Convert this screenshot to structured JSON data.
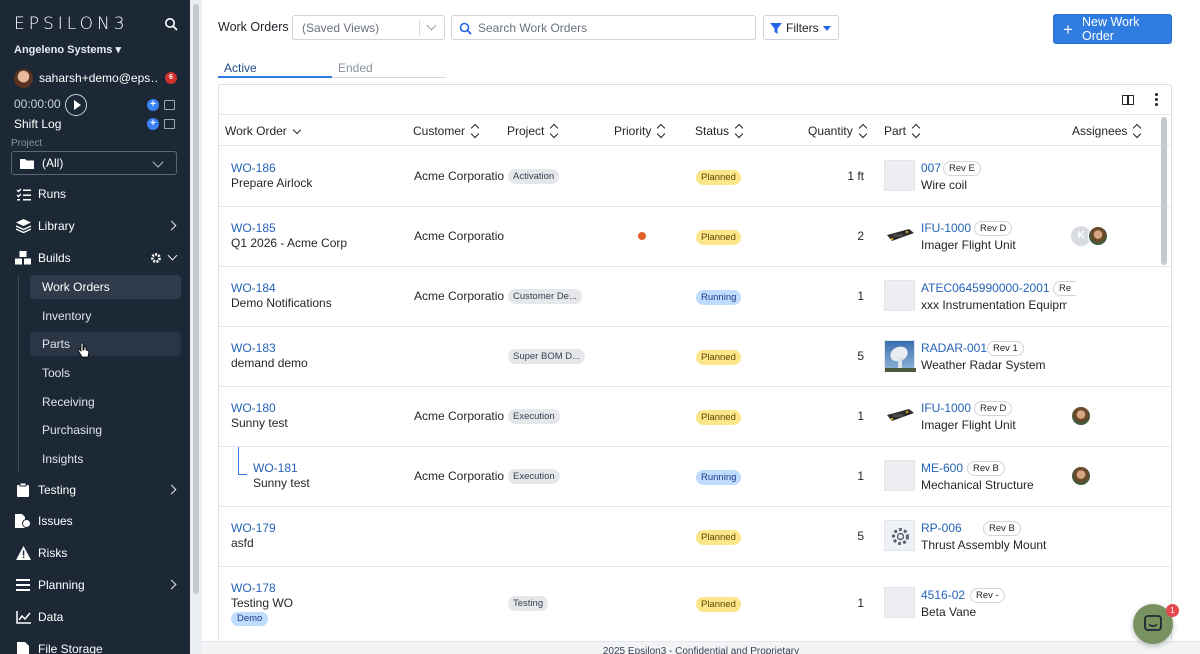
{
  "sidebar": {
    "logo": "EPSILON3",
    "org": "Angeleno Systems",
    "user": "saharsh+demo@eps…",
    "notification_count": "6",
    "timer": "00:00:00",
    "shift_log": "Shift Log",
    "project_label": "Project",
    "project_value": "(All)",
    "nav": {
      "runs": "Runs",
      "library": "Library",
      "builds": "Builds",
      "testing": "Testing",
      "issues": "Issues",
      "risks": "Risks",
      "planning": "Planning",
      "data": "Data",
      "file_storage": "File Storage"
    },
    "builds_sub": [
      "Work Orders",
      "Inventory",
      "Parts",
      "Tools",
      "Receiving",
      "Purchasing",
      "Insights"
    ]
  },
  "toolbar": {
    "title": "Work Orders",
    "saved_views": "(Saved Views)",
    "search_placeholder": "Search Work Orders",
    "filters": "Filters",
    "new_work_order": "New Work Order"
  },
  "tabs": {
    "active": "Active",
    "ended": "Ended"
  },
  "columns": {
    "work_order": "Work Order",
    "customer": "Customer",
    "project": "Project",
    "priority": "Priority",
    "status": "Status",
    "quantity": "Quantity",
    "part": "Part",
    "assignees": "Assignees"
  },
  "rows": [
    {
      "id": "WO-186",
      "name": "Prepare Airlock",
      "customer": "Acme Corporation",
      "project": "Activation",
      "status": "Planned",
      "quantity": "1 ft",
      "part_id": "007",
      "rev": "Rev E",
      "part_name": "Wire coil"
    },
    {
      "id": "WO-185",
      "name": "Q1 2026 - Acme Corp",
      "customer": "Acme Corporation",
      "project": "",
      "status": "Planned",
      "quantity": "2",
      "part_id": "IFU-1000",
      "rev": "Rev D",
      "part_name": "Imager Flight Unit",
      "assignee_initial": "K"
    },
    {
      "id": "WO-184",
      "name": "Demo Notifications",
      "customer": "Acme Corporation",
      "project": "Customer De...",
      "status": "Running",
      "quantity": "1",
      "part_id": "ATEC0645990000-2001",
      "rev": "Re",
      "part_name": "xxx Instrumentation Equipment"
    },
    {
      "id": "WO-183",
      "name": "demand demo",
      "customer": "",
      "project": "Super BOM D...",
      "status": "Planned",
      "quantity": "5",
      "part_id": "RADAR-001",
      "rev": "Rev 1",
      "part_name": "Weather Radar System"
    },
    {
      "id": "WO-180",
      "name": "Sunny test",
      "customer": "Acme Corporation",
      "project": "Execution",
      "status": "Planned",
      "quantity": "1",
      "part_id": "IFU-1000",
      "rev": "Rev D",
      "part_name": "Imager Flight Unit"
    },
    {
      "id": "WO-181",
      "name": "Sunny test",
      "customer": "Acme Corporation",
      "project": "Execution",
      "status": "Running",
      "quantity": "1",
      "part_id": "ME-600",
      "rev": "Rev B",
      "part_name": "Mechanical Structure"
    },
    {
      "id": "WO-179",
      "name": "asfd",
      "customer": "",
      "project": "",
      "status": "Planned",
      "quantity": "5",
      "part_id": "RP-006",
      "rev": "Rev B",
      "part_name": "Thrust Assembly Mount"
    },
    {
      "id": "WO-178",
      "name": "Testing WO",
      "customer": "",
      "project": "Testing",
      "status": "Planned",
      "quantity": "1",
      "part_id": "4516-02",
      "rev": "Rev -",
      "part_name": "Beta Vane",
      "tag": "Demo"
    }
  ],
  "footer": "2025 Epsilon3 - Confidential and Proprietary",
  "chat_badge": "1",
  "colors": {
    "sidebar_bg": "#1c2836",
    "accent": "#2f7de1",
    "planned": "#fde68a",
    "running": "#bfdbfe",
    "priority": "#e2622a"
  }
}
